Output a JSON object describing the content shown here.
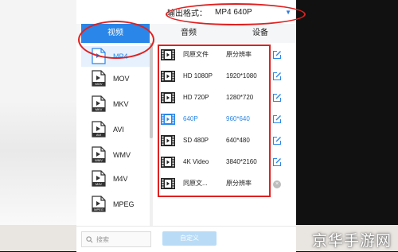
{
  "header": {
    "format_label": "输出格式：",
    "format_value": "MP4  640P",
    "arrow_icon": "triangle-down-icon"
  },
  "tabs": [
    {
      "label": "视频",
      "active": true
    },
    {
      "label": "音频",
      "active": false
    },
    {
      "label": "设备",
      "active": false
    }
  ],
  "formats": [
    {
      "name": "MP4",
      "tag": "",
      "active": true
    },
    {
      "name": "MOV",
      "tag": "MOV",
      "active": false
    },
    {
      "name": "MKV",
      "tag": "MKV",
      "active": false
    },
    {
      "name": "AVI",
      "tag": "AVI",
      "active": false
    },
    {
      "name": "WMV",
      "tag": "WMV",
      "active": false
    },
    {
      "name": "M4V",
      "tag": "M4V",
      "active": false
    },
    {
      "name": "MPEG",
      "tag": "MPEG",
      "active": false
    }
  ],
  "presets": [
    {
      "name": "同原文件",
      "res": "原分辨率",
      "action": "edit",
      "active": false
    },
    {
      "name": "HD 1080P",
      "res": "1920*1080",
      "action": "edit",
      "active": false
    },
    {
      "name": "HD 720P",
      "res": "1280*720",
      "action": "edit",
      "active": false
    },
    {
      "name": "640P",
      "res": "960*640",
      "action": "edit",
      "active": true
    },
    {
      "name": "SD 480P",
      "res": "640*480",
      "action": "edit",
      "active": false
    },
    {
      "name": "4K Video",
      "res": "3840*2160",
      "action": "edit",
      "active": false
    },
    {
      "name": "同原文...",
      "res": "原分辨率",
      "action": "delete",
      "active": false
    }
  ],
  "footer": {
    "search_placeholder": "搜索",
    "custom_button": "自定义"
  },
  "watermark": "京华手游网",
  "colors": {
    "accent": "#2a86e8",
    "highlight": "#e02020",
    "active_row": "#e6f1fd"
  }
}
